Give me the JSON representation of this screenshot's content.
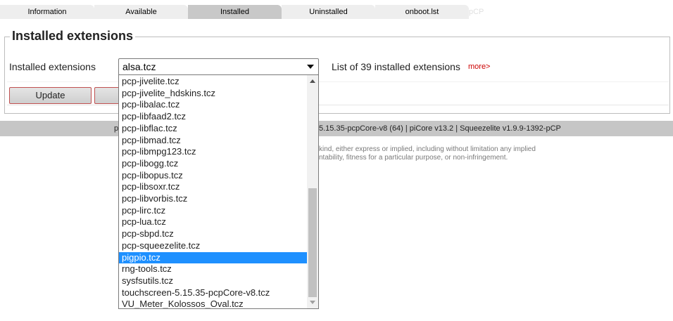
{
  "tabs": [
    {
      "label": "Information",
      "active": false
    },
    {
      "label": "Available",
      "active": false
    },
    {
      "label": "Installed",
      "active": true
    },
    {
      "label": "Uninstalled",
      "active": false
    },
    {
      "label": "onboot.lst",
      "active": false
    }
  ],
  "tab_ghost": "pCP",
  "section": {
    "legend": "Installed extensions",
    "label": "Installed extensions",
    "selected_value": "alsa.tcz",
    "count_text": "List of 39 installed extensions",
    "more_link": "more>",
    "update_button": "Update"
  },
  "footer": {
    "pcp_fragment": "p",
    "versions": "5.15.35-pcpCore-v8 (64) | piCore v13.2 | Squeezelite v1.9.9-1392-pCP",
    "disclaimer_line1": "kind, either express or implied, including without limitation any implied",
    "disclaimer_line2": "ntability, fitness for a particular purpose, or non-infringement."
  },
  "dropdown": {
    "items": [
      "pcp-jivelite.tcz",
      "pcp-jivelite_hdskins.tcz",
      "pcp-libalac.tcz",
      "pcp-libfaad2.tcz",
      "pcp-libflac.tcz",
      "pcp-libmad.tcz",
      "pcp-libmpg123.tcz",
      "pcp-libogg.tcz",
      "pcp-libopus.tcz",
      "pcp-libsoxr.tcz",
      "pcp-libvorbis.tcz",
      "pcp-lirc.tcz",
      "pcp-lua.tcz",
      "pcp-sbpd.tcz",
      "pcp-squeezelite.tcz",
      "pigpio.tcz",
      "rng-tools.tcz",
      "sysfsutils.tcz",
      "touchscreen-5.15.35-pcpCore-v8.tcz",
      "VU_Meter_Kolossos_Oval.tcz"
    ],
    "highlighted_item": "pigpio.tcz"
  },
  "colors": {
    "highlight": "#1e90ff",
    "more_link": "#cc0000",
    "button_border": "#c05050"
  }
}
